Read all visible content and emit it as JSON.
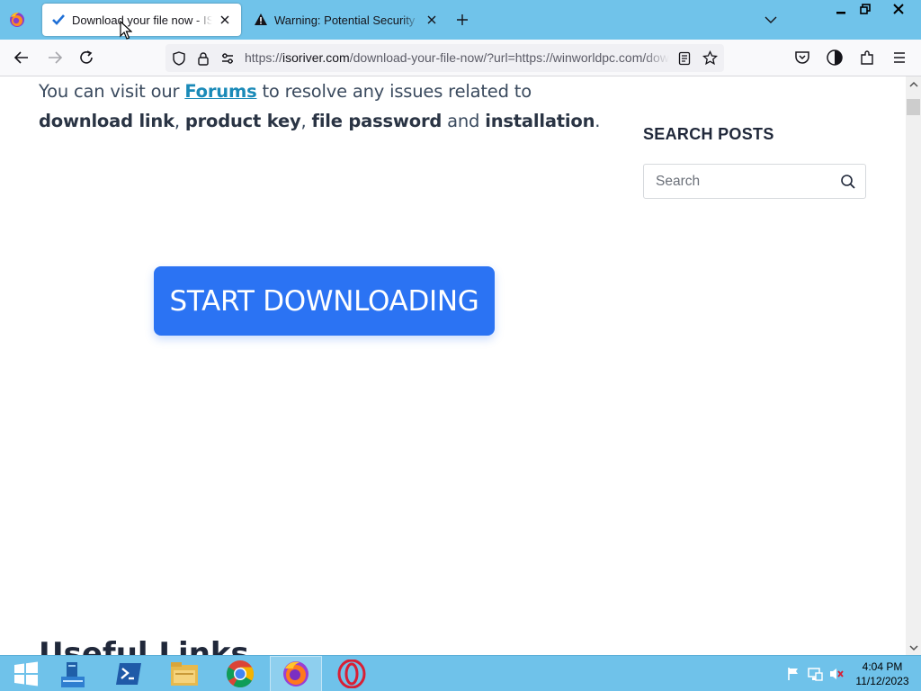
{
  "browser": {
    "tabs": [
      {
        "title": "Download your file now - ISORiver",
        "active": true,
        "favicon": "blue-checkmark-icon"
      },
      {
        "title": "Warning: Potential Security Risk Ahead",
        "active": false,
        "favicon": "warning-icon"
      }
    ],
    "url": {
      "prefix": "https://",
      "host": "isoriver.com",
      "path": "/download-your-file-now/?url=https://winworldpc.com/download/"
    }
  },
  "page": {
    "intro": {
      "part1": "You can visit our ",
      "forums_link": "Forums",
      "part2": " to resolve any issues related to ",
      "download_link": "download link",
      "sep1": ", ",
      "product_key": "product key",
      "sep2": ", ",
      "file_password": "file password",
      "part3": " and ",
      "installation": "installation",
      "end": "."
    },
    "cta_label": "START DOWNLOADING",
    "sidebar": {
      "search_title": "SEARCH POSTS",
      "search_placeholder": "Search"
    },
    "useful_links_heading": "Useful Links"
  },
  "taskbar": {
    "apps": [
      "start",
      "file-explorer",
      "powershell",
      "file-manager",
      "chrome",
      "firefox",
      "opera"
    ],
    "clock_time": "4:04 PM",
    "clock_date": "11/12/2023"
  },
  "colors": {
    "titlebar": "#70c3ea",
    "cta": "#2b73f3",
    "link": "#1a8ab8",
    "taskbar": "#6fc2ea"
  }
}
